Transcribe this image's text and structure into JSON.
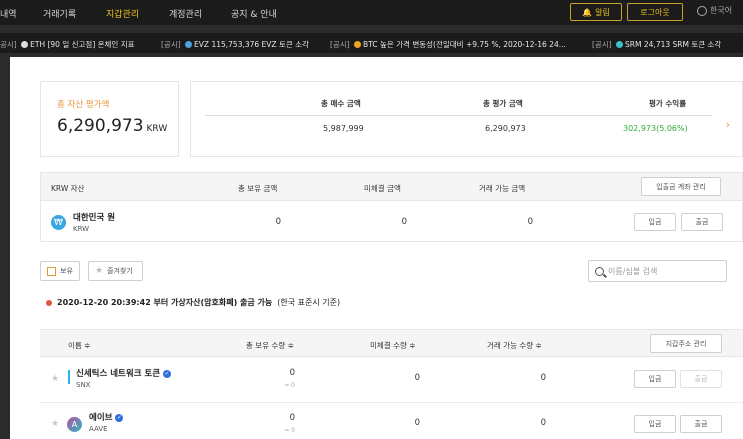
{
  "nav": {
    "items": [
      "내역",
      "거래기록",
      "지갑관리",
      "계정관리",
      "공지 & 안내"
    ],
    "alert_label": "알림",
    "logout_label": "로그아웃",
    "language_label": "한국어"
  },
  "ticker": [
    {
      "tag": "공시]",
      "coin": "ETH",
      "text": "[90 일 신고점] 온체인 지표"
    },
    {
      "tag": "[공시]",
      "coin": "EVZ",
      "text": "115,753,376 EVZ 토큰 소각"
    },
    {
      "tag": "[공시]",
      "coin": "BTC",
      "text": "높은 가격 변동성(전일대비 +9.75 %, 2020-12-16 24..."
    },
    {
      "tag": "[공시]",
      "coin": "SRM",
      "text": "24,713 SRM 토큰 소각"
    }
  ],
  "summary": {
    "total_label": "총 자산 평가액",
    "total_value": "6,290,973",
    "total_unit": "KRW",
    "headers": [
      "총 매수 금액",
      "총 평가 금액",
      "평가 수익률"
    ],
    "values": [
      "5,987,999",
      "6,290,973",
      "302,973(5.06%)"
    ],
    "chevron": "›"
  },
  "krw": {
    "headers": [
      "KRW 자산",
      "총 보유 금액",
      "미체결 금액",
      "거래 가능 금액"
    ],
    "account_button": "입출금 계좌 관리",
    "asset_name": "대한민국 원",
    "asset_symbol": "KRW",
    "values": [
      "0",
      "0",
      "0"
    ],
    "deposit": "입금",
    "withdraw": "출금"
  },
  "filters": {
    "holdings_label": "보유",
    "favorites_label": "즐겨찾기",
    "search_placeholder": "이름/심볼 검색"
  },
  "notice": {
    "bold": "2020-12-20 20:39:42 부터 가상자산(암호화폐) 출금 가능",
    "rest": "(한국 표준시 기준)"
  },
  "coins": {
    "headers": [
      "이름 ≑",
      "총 보유 수량 ≑",
      "미체결 수량 ≑",
      "거래 가능 수량 ≑"
    ],
    "manage_button": "지갑주소 관리",
    "rows": [
      {
        "name": "신세틱스 네트워크 토큰",
        "symbol": "SNX",
        "total": "0",
        "approx": "≈ 0",
        "pending": "0",
        "available": "0",
        "deposit": "입금",
        "withdraw": "출금"
      },
      {
        "name": "에이브",
        "symbol": "AAVE",
        "total": "0",
        "approx": "≈ 0",
        "pending": "0",
        "available": "0",
        "deposit": "입금",
        "withdraw": "출금"
      }
    ]
  },
  "colors": {
    "accent": "#f2c21b",
    "orange": "#e8973a",
    "profit_green": "#33aa33",
    "ticker_bg": "#1b1b1b"
  }
}
